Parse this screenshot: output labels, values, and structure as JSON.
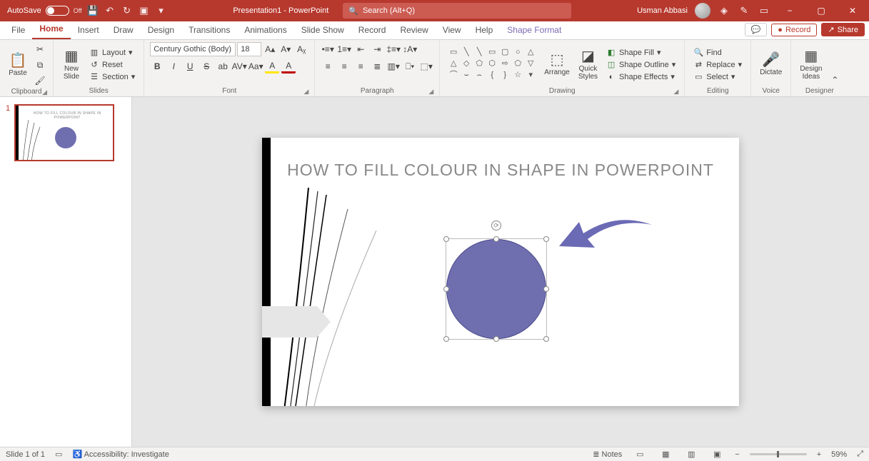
{
  "titlebar": {
    "autosave_label": "AutoSave",
    "autosave_state": "Off",
    "doc_title": "Presentation1 - PowerPoint",
    "search_placeholder": "Search (Alt+Q)",
    "user_name": "Usman Abbasi"
  },
  "tabs": {
    "file": "File",
    "home": "Home",
    "insert": "Insert",
    "draw": "Draw",
    "design": "Design",
    "transitions": "Transitions",
    "animations": "Animations",
    "slideshow": "Slide Show",
    "record": "Record",
    "review": "Review",
    "view": "View",
    "help": "Help",
    "shape_format": "Shape Format",
    "record_btn": "Record",
    "share_btn": "Share"
  },
  "ribbon": {
    "clipboard": {
      "label": "Clipboard",
      "paste": "Paste"
    },
    "slides": {
      "label": "Slides",
      "new_slide": "New\nSlide",
      "layout": "Layout",
      "reset": "Reset",
      "section": "Section"
    },
    "font": {
      "label": "Font",
      "name": "Century Gothic (Body)",
      "size": "18"
    },
    "paragraph": {
      "label": "Paragraph"
    },
    "drawing": {
      "label": "Drawing",
      "arrange": "Arrange",
      "quick_styles": "Quick\nStyles",
      "shape_fill": "Shape Fill",
      "shape_outline": "Shape Outline",
      "shape_effects": "Shape Effects"
    },
    "editing": {
      "label": "Editing",
      "find": "Find",
      "replace": "Replace",
      "select": "Select"
    },
    "voice": {
      "label": "Voice",
      "dictate": "Dictate"
    },
    "designer": {
      "label": "Designer",
      "design_ideas": "Design\nIdeas"
    }
  },
  "slide": {
    "number": "1",
    "title": "HOW TO FILL COLOUR IN SHAPE IN POWERPOINT",
    "thumb_title": "HOW TO FILL COLOUR IN SHAPE IN POWERPOINT",
    "circle_color": "#6f6fb0",
    "arrow_color": "#6a6ab5"
  },
  "status": {
    "slide_counter": "Slide 1 of 1",
    "accessibility": "Accessibility: Investigate",
    "notes": "Notes",
    "zoom": "59%"
  }
}
